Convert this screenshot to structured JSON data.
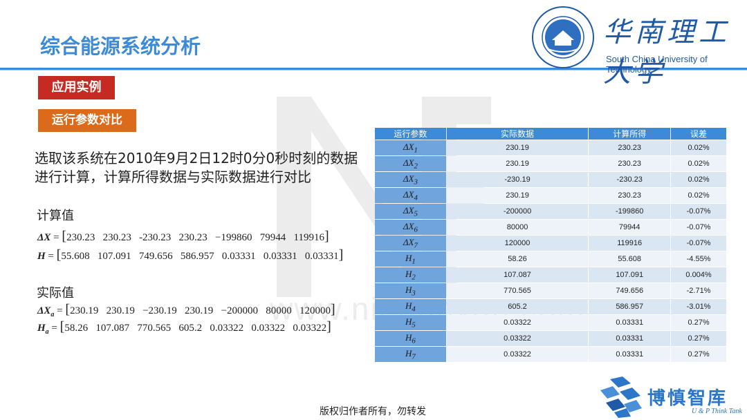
{
  "header": {
    "title": "综合能源系统分析",
    "university_cn": "华南理工大学",
    "university_en": "South China University of Technology"
  },
  "tags": {
    "example": "应用实例",
    "comparison": "运行参数对比"
  },
  "intro": "选取该系统在2010年9月2日12时0分0秒时刻的数据进行计算，计算所得数据与实际数据进行对比",
  "calculated": {
    "label": "计算值",
    "dx_name": "ΔX",
    "dx_values": "230.23   230.23   -230.23   230.23   −199860   79944   119916",
    "h_name": "H",
    "h_values": "55.608   107.091   749.656   586.957   0.03331   0.03331   0.03331"
  },
  "actual": {
    "label": "实际值",
    "dx_name": "ΔX",
    "dx_sub": "a",
    "dx_values": "230.19   230.19   −230.19   230.19   −200000   80000   120000",
    "h_name": "H",
    "h_sub": "a",
    "h_values": "58.26   107.087   770.565   605.2   0.03322   0.03322   0.03322"
  },
  "table": {
    "headers": [
      "运行参数",
      "实际数据",
      "计算所得",
      "误差"
    ],
    "rows": [
      {
        "param": "ΔX",
        "sub": "1",
        "actual": "230.19",
        "calc": "230.23",
        "error": "0.02%"
      },
      {
        "param": "ΔX",
        "sub": "2",
        "actual": "230.19",
        "calc": "230.23",
        "error": "0.02%"
      },
      {
        "param": "ΔX",
        "sub": "3",
        "actual": "-230.19",
        "calc": "-230.23",
        "error": "0.02%"
      },
      {
        "param": "ΔX",
        "sub": "4",
        "actual": "230.19",
        "calc": "230.23",
        "error": "0.02%"
      },
      {
        "param": "ΔX",
        "sub": "5",
        "actual": "-200000",
        "calc": "-199860",
        "error": "-0.07%"
      },
      {
        "param": "ΔX",
        "sub": "6",
        "actual": "80000",
        "calc": "79944",
        "error": "-0.07%"
      },
      {
        "param": "ΔX",
        "sub": "7",
        "actual": "120000",
        "calc": "119916",
        "error": "-0.07%"
      },
      {
        "param": "H",
        "sub": "1",
        "actual": "58.26",
        "calc": "55.608",
        "error": "-4.55%"
      },
      {
        "param": "H",
        "sub": "2",
        "actual": "107.087",
        "calc": "107.091",
        "error": "0.004%"
      },
      {
        "param": "H",
        "sub": "3",
        "actual": "770.565",
        "calc": "749.656",
        "error": "-2.71%"
      },
      {
        "param": "H",
        "sub": "4",
        "actual": "605.2",
        "calc": "586.957",
        "error": "-3.01%"
      },
      {
        "param": "H",
        "sub": "5",
        "actual": "0.03322",
        "calc": "0.03331",
        "error": "0.27%"
      },
      {
        "param": "H",
        "sub": "6",
        "actual": "0.03322",
        "calc": "0.03331",
        "error": "0.27%"
      },
      {
        "param": "H",
        "sub": "7",
        "actual": "0.03322",
        "calc": "0.03331",
        "error": "0.27%"
      }
    ]
  },
  "watermark": "www.niedunyan.com",
  "footer": "版权归作者所有，勿转发",
  "brand": {
    "cn": "博慎智库",
    "en": "U & P Think Tank"
  },
  "colors": {
    "accent_blue": "#3d8ad6",
    "tag_red": "#c52b22",
    "tag_orange": "#db6b1a",
    "param_cell": "#6fa4dc"
  }
}
